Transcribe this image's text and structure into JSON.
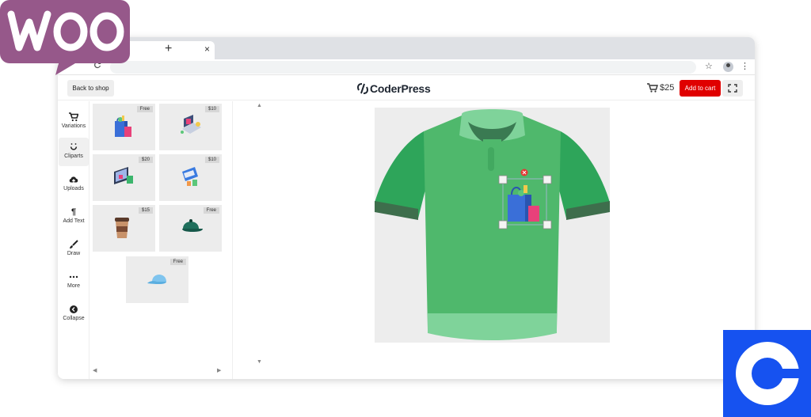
{
  "overlay": {
    "woo_logo": "WOO",
    "woo_color": "#96588a",
    "coin_logo_color": "#1652f0"
  },
  "browser": {
    "tab_close": "×",
    "new_tab": "+",
    "reload_icon": "reload-icon",
    "star_icon": "star-icon",
    "menu_icon": "⋮"
  },
  "header": {
    "back_label": "Back to shop",
    "brand_name": "CoderPress",
    "cart_total": "$25",
    "add_to_cart_label": "Add to cart",
    "accent_color": "#e00000"
  },
  "sidebar": {
    "items": [
      {
        "label": "Variations",
        "icon": "cart-icon",
        "active": false
      },
      {
        "label": "Cliparts",
        "icon": "smile-icon",
        "active": true
      },
      {
        "label": "Uploads",
        "icon": "cloud-upload-icon",
        "active": false
      },
      {
        "label": "Add Text",
        "icon": "pilcrow-icon",
        "active": false
      },
      {
        "label": "Draw",
        "icon": "brush-icon",
        "active": false
      },
      {
        "label": "More",
        "icon": "more-icon",
        "active": false
      },
      {
        "label": "Collapse",
        "icon": "collapse-icon",
        "active": false
      }
    ]
  },
  "cliparts": [
    {
      "price": "Free",
      "icon": "shopping-bags-icon"
    },
    {
      "price": "$10",
      "icon": "laptop-shopping-icon"
    },
    {
      "price": "$20",
      "icon": "monitor-bag-icon"
    },
    {
      "price": "$10",
      "icon": "card-payment-icon"
    },
    {
      "price": "$15",
      "icon": "coffee-cup-icon"
    },
    {
      "price": "Free",
      "icon": "green-cap-icon"
    },
    {
      "price": "Free",
      "icon": "blue-cap-icon"
    }
  ],
  "design": {
    "product": "polo-shirt",
    "shirt_color": "#4fb86c",
    "selected_clipart": "shopping-bags-icon"
  }
}
